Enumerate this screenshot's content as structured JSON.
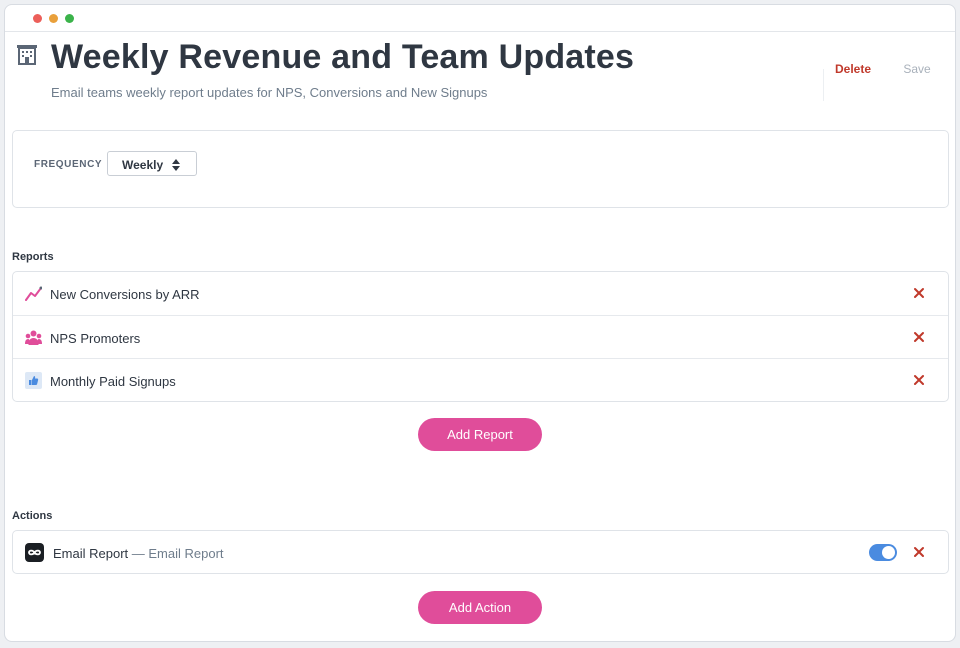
{
  "window": {
    "colors": {
      "close": "#ec5f5a",
      "minimize": "#e9a03b",
      "maximize": "#3bb34a"
    }
  },
  "header": {
    "icon": "building-icon",
    "title": "Weekly Revenue and Team Updates",
    "subtitle": "Email teams weekly report updates for NPS, Conversions and New Signups",
    "delete_label": "Delete",
    "save_label": "Save"
  },
  "frequency": {
    "label": "FREQUENCY",
    "value": "Weekly",
    "icon": "sort-updown-icon"
  },
  "reports": {
    "label": "Reports",
    "items": [
      {
        "label": "New Conversions by ARR",
        "icon": "trend-line-icon"
      },
      {
        "label": "NPS Promoters",
        "icon": "people-group-icon"
      },
      {
        "label": "Monthly Paid Signups",
        "icon": "thumbs-up-icon"
      }
    ],
    "add_label": "Add Report"
  },
  "actions": {
    "label": "Actions",
    "items": [
      {
        "name": "Email Report",
        "separator": "—",
        "subtitle": "Email Report",
        "icon": "infinity-icon",
        "enabled": true
      }
    ],
    "add_label": "Add Action"
  },
  "colors": {
    "accent": "#e04d9a",
    "danger": "#c0392b",
    "toggle_on": "#4a8be0",
    "text": "#2f3742",
    "muted": "#6f7d8c"
  }
}
